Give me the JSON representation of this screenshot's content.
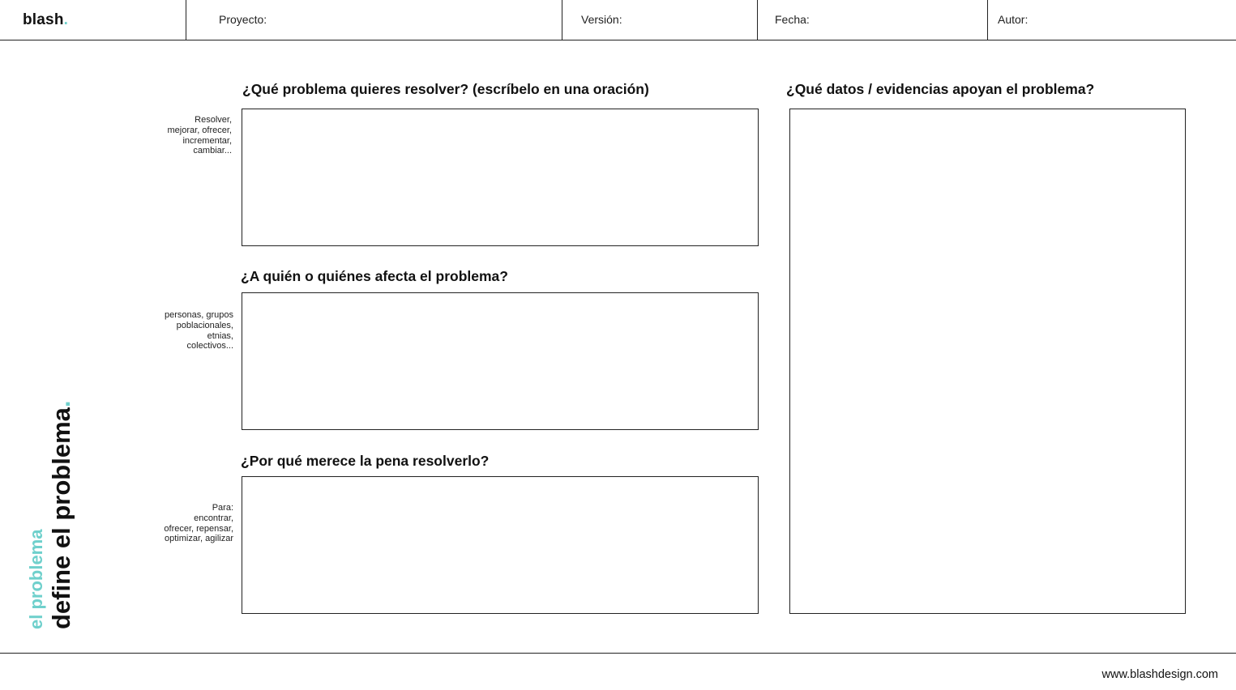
{
  "header": {
    "logo_text": "blash",
    "logo_dot": ".",
    "fields": [
      {
        "label": "Proyecto:"
      },
      {
        "label": "Versión:"
      },
      {
        "label": "Fecha:"
      },
      {
        "label": "Autor:"
      }
    ]
  },
  "questions": {
    "q1": {
      "title": "¿Qué problema quieres resolver? (escríbelo en una oración)",
      "hint": [
        "Resolver,",
        "mejorar, ofrecer,",
        "incrementar,",
        "cambiar..."
      ]
    },
    "q2": {
      "title": "¿A quién o quiénes afecta el problema?",
      "hint": [
        "personas, grupos",
        "poblacionales,",
        "etnias,",
        "colectivos..."
      ]
    },
    "q3": {
      "title": "¿Por qué merece la pena resolverlo?",
      "hint": [
        "Para:",
        "encontrar,",
        "ofrecer, repensar,",
        "optimizar, agilizar"
      ]
    },
    "q4": {
      "title": "¿Qué datos / evidencias apoyan el problema?"
    }
  },
  "sidebar": {
    "subtitle": "el problema",
    "title": "define el problema",
    "title_dot": "."
  },
  "footer": {
    "url": "www.blashdesign.com"
  },
  "colors": {
    "accent": "#6fd0cc",
    "text": "#111111",
    "border": "#222222"
  }
}
